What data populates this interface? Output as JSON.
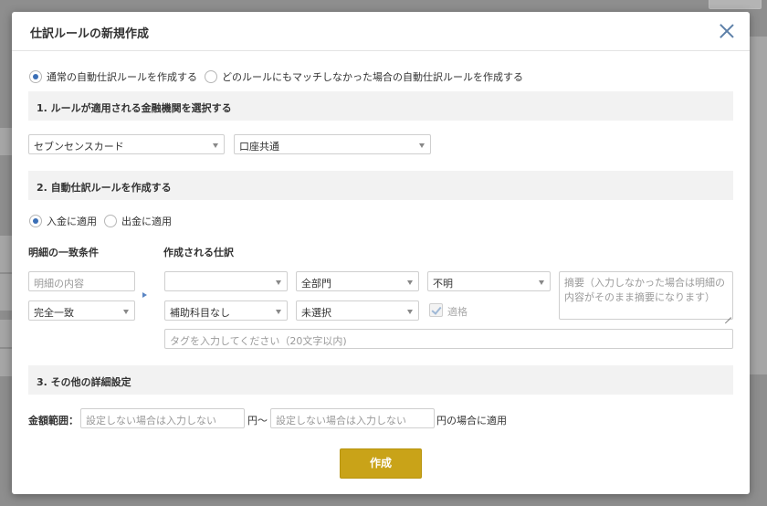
{
  "background": {
    "top_button_text": ""
  },
  "modal": {
    "title": "仕訳ルールの新規作成",
    "rule_type": {
      "options": [
        {
          "label": "通常の自動仕訳ルールを作成する",
          "checked": true
        },
        {
          "label": "どのルールにもマッチしなかった場合の自動仕訳ルールを作成する",
          "checked": false
        }
      ]
    },
    "section1": {
      "title": "1. ルールが適用される金融機関を選択する",
      "institution": "セブンセンスカード",
      "account": "口座共通"
    },
    "section2": {
      "title": "2. 自動仕訳ルールを作成する",
      "direction": {
        "options": [
          {
            "label": "入金に適用",
            "checked": true
          },
          {
            "label": "出金に適用",
            "checked": false
          }
        ]
      },
      "match_heading": "明細の一致条件",
      "create_heading": "作成される仕訳",
      "detail_placeholder": "明細の内容",
      "match_type": "完全一致",
      "account_item": "",
      "sub_account": "補助科目なし",
      "department": "全部門",
      "not_selected": "未選択",
      "tax": "不明",
      "qualified_label": "適格",
      "memo_placeholder": "摘要（入力しなかった場合は明細の内容がそのまま摘要になります）",
      "tag_placeholder": "タグを入力してください（20文字以内)"
    },
    "section3": {
      "title": "3. その他の詳細設定",
      "amount_label": "金額範囲：",
      "min_placeholder": "設定しない場合は入力しない",
      "yen_from": "円〜",
      "max_placeholder": "設定しない場合は入力しない",
      "yen_suffix": "円の場合に適用"
    },
    "submit_label": "作成"
  },
  "colors": {
    "accent": "#3b6fb6",
    "submit": "#c9a318",
    "close": "#5c7fa8"
  }
}
